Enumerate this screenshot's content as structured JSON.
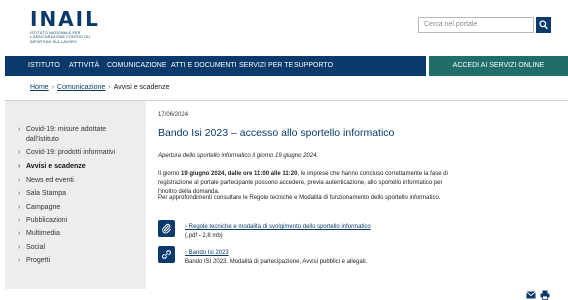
{
  "brand": {
    "name": "INAIL",
    "tagline": "ISTITUTO NAZIONALE PER L'ASSICURAZIONE CONTRO GLI INFORTUNI SUL LAVORO"
  },
  "search": {
    "placeholder": "Cerca nel portale"
  },
  "nav": {
    "items": [
      "ISTITUTO",
      "ATTIVITÀ",
      "COMUNICAZIONE",
      "ATTI E DOCUMENTI",
      "SERVIZI PER TE",
      "SUPPORTO"
    ],
    "cta": "ACCEDI AI SERVIZI ONLINE"
  },
  "breadcrumb": {
    "home": "Home",
    "section": "Comunicazione",
    "current": "Avvisi e scadenze"
  },
  "sidebar": {
    "items": [
      {
        "label": "Covid-19: misure adottate dall'Istituto"
      },
      {
        "label": "Covid-19: prodotti informativi"
      },
      {
        "label": "Avvisi e scadenze"
      },
      {
        "label": "News ed eventi"
      },
      {
        "label": "Sala Stampa"
      },
      {
        "label": "Campagne"
      },
      {
        "label": "Pubblicazioni"
      },
      {
        "label": "Multimedia"
      },
      {
        "label": "Social"
      },
      {
        "label": "Progetti"
      }
    ]
  },
  "article": {
    "date": "17/06/2024",
    "title": "Bando Isi 2023 – accesso allo sportello informatico",
    "lead": "Apertura dello sportello informatico il giorno 19 giugno 2024.",
    "p1_pre": "Il giorno ",
    "p1_bold": "19 giugno 2024, dalle ore 11:00 alle 11:20",
    "p1_post": ", le imprese che hanno concluso correttamente la fase di registrazione al portale partecipante possono accedere, previa autenticazione, allo sportello informatico per l'inoltro della domanda.",
    "p2": "Per approfondimenti consultare le Regole tecniche e Modalità di funzionamento dello sportello informatico."
  },
  "attachments": [
    {
      "icon": "paperclip-icon",
      "title": "Regole tecniche e modalità di svolgimento dello sportello informatico",
      "sub": "(.pdf - 2,8 mb)"
    },
    {
      "icon": "link-icon",
      "title": "Bando Isi 2023",
      "sub": "Bando ISI 2023. Modalità di partecipazione, Avvisi pubblici e allegati."
    }
  ],
  "footer_icons": [
    "mail-icon",
    "print-icon"
  ],
  "colors": {
    "primary": "#0a3a6b",
    "cta": "#1f6e68",
    "sidebar_bg": "#ededed"
  }
}
